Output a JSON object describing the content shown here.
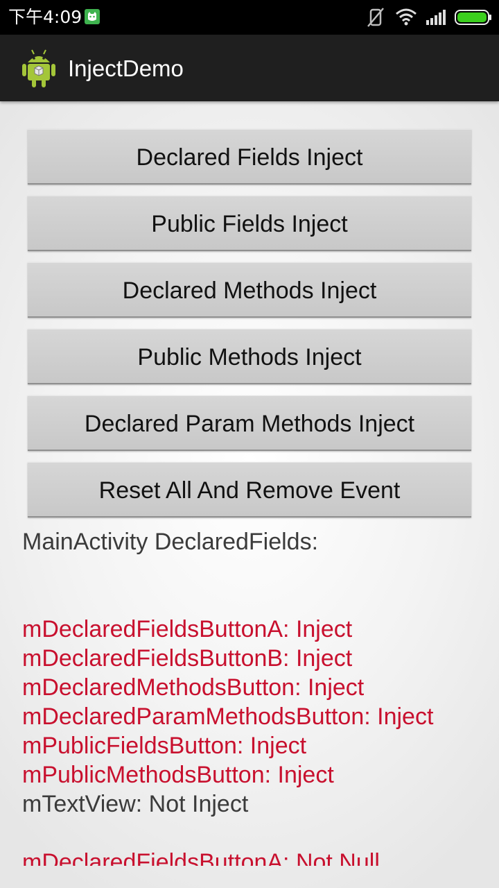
{
  "status_bar": {
    "time": "下午4:09"
  },
  "action_bar": {
    "title": "InjectDemo",
    "icon": "android-robot-icon"
  },
  "buttons": [
    {
      "label": "Declared Fields Inject"
    },
    {
      "label": "Public Fields Inject"
    },
    {
      "label": "Declared Methods Inject"
    },
    {
      "label": "Public Methods Inject"
    },
    {
      "label": "Declared Param Methods Inject"
    },
    {
      "label": "Reset All And Remove Event"
    }
  ],
  "log": {
    "header": "MainActivity DeclaredFields:",
    "lines": [
      {
        "text": "mDeclaredFieldsButtonA: Inject",
        "color": "#c8102e"
      },
      {
        "text": "mDeclaredFieldsButtonB: Inject",
        "color": "#c8102e"
      },
      {
        "text": "mDeclaredMethodsButton: Inject",
        "color": "#c8102e"
      },
      {
        "text": "mDeclaredParamMethodsButton: Inject",
        "color": "#c8102e"
      },
      {
        "text": "mPublicFieldsButton: Inject",
        "color": "#c8102e"
      },
      {
        "text": "mPublicMethodsButton: Inject",
        "color": "#c8102e"
      },
      {
        "text": "mTextView: Not Inject",
        "color": "#3b3b3b"
      }
    ],
    "trailing_line": "mDeclaredFieldsButtonA: Not Null"
  },
  "colors": {
    "inject": "#c8102e",
    "not_inject": "#3b3b3b",
    "status_bar": "#000000",
    "action_bar": "#1f1f1f",
    "button": "#cfcfcf",
    "battery": "#3ccf1e"
  }
}
